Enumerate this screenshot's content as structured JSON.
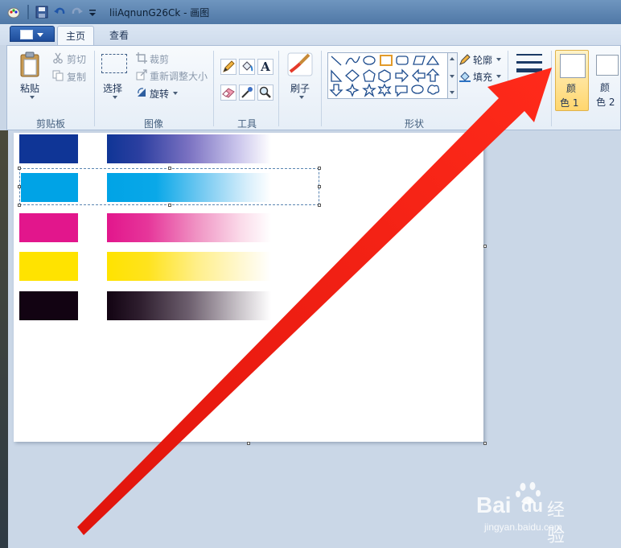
{
  "window": {
    "title": "liiAqnunG26Ck - 画图"
  },
  "tabs": [
    {
      "label": "主页",
      "active": true
    },
    {
      "label": "查看",
      "active": false
    }
  ],
  "ribbon": {
    "clipboard": {
      "paste_label": "粘贴",
      "cut_label": "剪切",
      "copy_label": "复制",
      "group_label": "剪贴板"
    },
    "image": {
      "select_label": "选择",
      "crop_label": "裁剪",
      "resize_label": "重新调整大小",
      "rotate_label": "旋转",
      "group_label": "图像"
    },
    "tools": {
      "group_label": "工具",
      "text_tool_glyph": "A"
    },
    "brushes": {
      "label": "刷子"
    },
    "shapes": {
      "outline_label": "轮廓",
      "fill_label": "填充",
      "group_label": "形状"
    },
    "colors": {
      "color1_label_line1": "颜",
      "color1_label_line2": "色 1",
      "color2_label_line1": "颜",
      "color2_label_line2": "色 2"
    }
  },
  "canvas": {
    "swatch_colors": [
      "#0f3596",
      "#00a3e6",
      "#e2168c",
      "#ffe300",
      "#120312"
    ]
  },
  "watermark": {
    "brand": "Bai",
    "brand_suffix": "经验",
    "url": "jingyan.baidu.com"
  },
  "colors": {
    "arrow": "#f2180f",
    "accent": "#1e4c9a"
  }
}
